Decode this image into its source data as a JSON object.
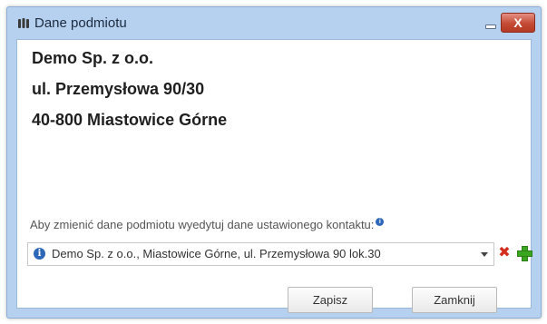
{
  "window": {
    "title": "Dane podmiotu",
    "close_glyph": "X",
    "icons": {
      "title": "app-icon",
      "minimize": "minimize-icon",
      "close": "close-icon"
    }
  },
  "entity": {
    "name": "Demo Sp. z o.o.",
    "street": "ul. Przemysłowa 90/30",
    "city": "40-800 Miastowice Górne"
  },
  "contact": {
    "hint": "Aby zmienić dane podmiotu wyedytuj dane ustawionego kontaktu:",
    "hint_info_glyph": "i",
    "selected_value": "Demo Sp. z o.o., Miastowice Górne, ul. Przemysłowa 90 lok.30",
    "option_icon_glyph": "i",
    "delete_glyph": "✖",
    "icons": {
      "info": "info-icon",
      "dropdown": "chevron-down-icon",
      "delete": "delete-icon",
      "add": "add-icon"
    }
  },
  "buttons": {
    "save": "Zapisz",
    "close": "Zamknij"
  },
  "colors": {
    "titlebar": "#b6d1ef",
    "close_button": "#c44b35",
    "info_blue": "#2d67b8",
    "delete_red": "#d32f1f",
    "add_green": "#3aa51f"
  }
}
